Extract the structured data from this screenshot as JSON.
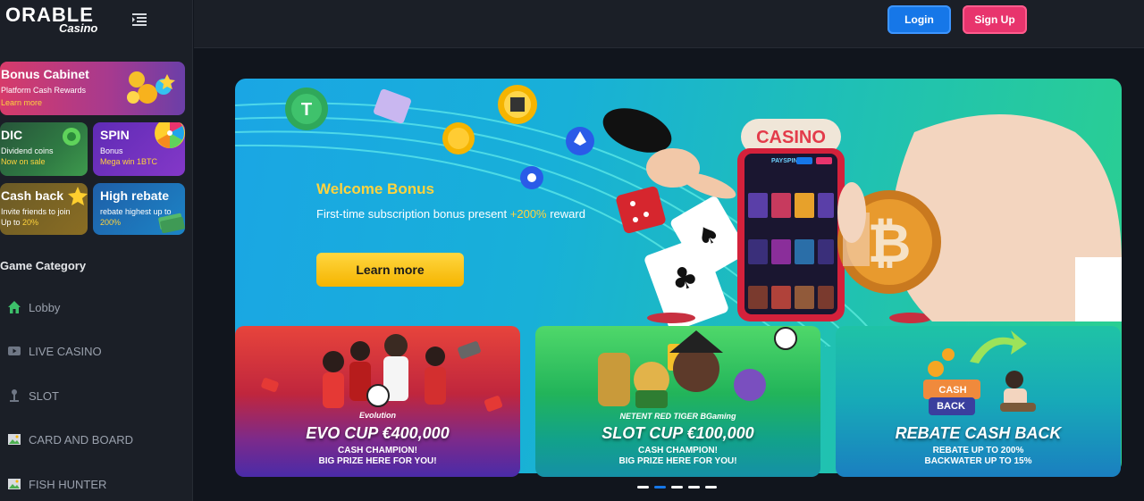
{
  "brand": {
    "name": "ORABLE",
    "sub": "Casino"
  },
  "header": {
    "login_label": "Login",
    "signup_label": "Sign Up"
  },
  "sidebar": {
    "cards": {
      "bonus_cabinet": {
        "title": "Bonus Cabinet",
        "sub": "Platform Cash Rewards",
        "extra": "Learn more"
      },
      "dic": {
        "title": "DIC",
        "sub": "Dividend coins",
        "extra": "Now on sale"
      },
      "spin": {
        "title": "SPIN",
        "sub": "Bonus",
        "extra": "Mega win 1BTC"
      },
      "cashback": {
        "title": "Cash back",
        "sub": "Invite friends to join",
        "extra_prefix": "Up to ",
        "extra_value": "20%"
      },
      "rebate": {
        "title": "High rebate",
        "sub": "rebate highest up to",
        "extra": "200%"
      }
    },
    "category_title": "Game Category",
    "categories": [
      {
        "label": "Lobby",
        "icon": "home-icon"
      },
      {
        "label": "LIVE CASINO",
        "icon": "video-icon"
      },
      {
        "label": "SLOT",
        "icon": "slot-icon"
      },
      {
        "label": "CARD AND BOARD",
        "icon": "image-icon"
      },
      {
        "label": "FISH HUNTER",
        "icon": "image-icon"
      }
    ]
  },
  "hero": {
    "title": "Welcome Bonus",
    "desc_prefix": "First-time subscription bonus present ",
    "desc_highlight": "+200%",
    "desc_suffix": " reward",
    "button": "Learn more",
    "casino_sign": "CASINO",
    "phone_brand": "PAYSPIN"
  },
  "promos": [
    {
      "brand": "Evolution",
      "title": "EVO CUP €400,000",
      "line1": "CASH CHAMPION!",
      "line2": "BIG PRIZE HERE FOR YOU!"
    },
    {
      "brand": "NETENT   RED TIGER   BGaming",
      "title": "SLOT CUP  €100,000",
      "line1": "CASH CHAMPION!",
      "line2": "BIG PRIZE HERE FOR YOU!"
    },
    {
      "badge_top": "CASH",
      "badge_bottom": "BACK",
      "title": "REBATE CASH BACK",
      "line1": "REBATE UP TO 200%",
      "line2": "BACKWATER UP TO 15%"
    }
  ],
  "carousel": {
    "count": 5,
    "active_index": 1
  },
  "colors": {
    "accent": "#1677e8",
    "signup": "#e8346d",
    "gold": "#ffd33d"
  }
}
